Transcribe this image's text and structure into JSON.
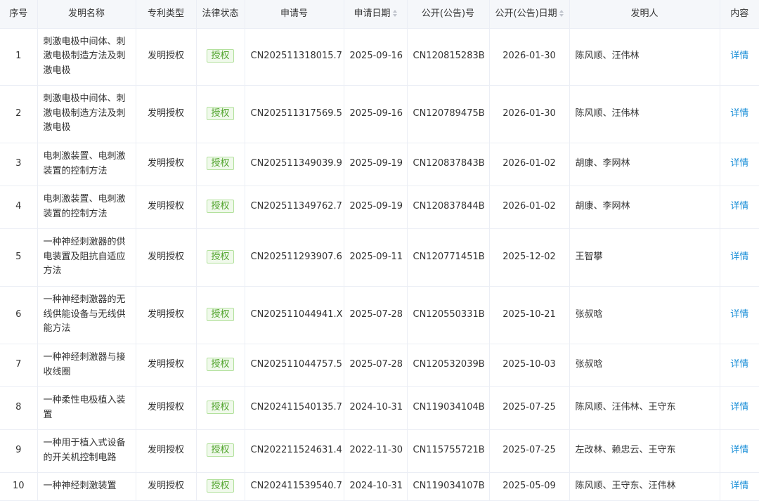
{
  "headers": {
    "index": "序号",
    "name": "发明名称",
    "type": "专利类型",
    "status": "法律状态",
    "app_no": "申请号",
    "app_date": "申请日期",
    "pub_no": "公开(公告)号",
    "pub_date": "公开(公告)日期",
    "inventor": "发明人",
    "content": "内容"
  },
  "rows": [
    {
      "index": "1",
      "name": "刺激电极中间体、刺激电极制造方法及刺激电极",
      "type": "发明授权",
      "status": "授权",
      "app_no": "CN202511318015.7",
      "app_date": "2025-09-16",
      "pub_no": "CN120815283B",
      "pub_date": "2026-01-30",
      "inventor": "陈风顺、汪伟林",
      "detail": "详情"
    },
    {
      "index": "2",
      "name": "刺激电极中间体、刺激电极制造方法及刺激电极",
      "type": "发明授权",
      "status": "授权",
      "app_no": "CN202511317569.5",
      "app_date": "2025-09-16",
      "pub_no": "CN120789475B",
      "pub_date": "2026-01-30",
      "inventor": "陈风顺、汪伟林",
      "detail": "详情"
    },
    {
      "index": "3",
      "name": "电刺激装置、电刺激装置的控制方法",
      "type": "发明授权",
      "status": "授权",
      "app_no": "CN202511349039.9",
      "app_date": "2025-09-19",
      "pub_no": "CN120837843B",
      "pub_date": "2026-01-02",
      "inventor": "胡康、李网林",
      "detail": "详情"
    },
    {
      "index": "4",
      "name": "电刺激装置、电刺激装置的控制方法",
      "type": "发明授权",
      "status": "授权",
      "app_no": "CN202511349762.7",
      "app_date": "2025-09-19",
      "pub_no": "CN120837844B",
      "pub_date": "2026-01-02",
      "inventor": "胡康、李网林",
      "detail": "详情"
    },
    {
      "index": "5",
      "name": "一种神经刺激器的供电装置及阻抗自适应方法",
      "type": "发明授权",
      "status": "授权",
      "app_no": "CN202511293907.6",
      "app_date": "2025-09-11",
      "pub_no": "CN120771451B",
      "pub_date": "2025-12-02",
      "inventor": "王智攀",
      "detail": "详情"
    },
    {
      "index": "6",
      "name": "一种神经刺激器的无线供能设备与无线供能方法",
      "type": "发明授权",
      "status": "授权",
      "app_no": "CN202511044941.X",
      "app_date": "2025-07-28",
      "pub_no": "CN120550331B",
      "pub_date": "2025-10-21",
      "inventor": "张叔晗",
      "detail": "详情"
    },
    {
      "index": "7",
      "name": "一种神经刺激器与接收线圈",
      "type": "发明授权",
      "status": "授权",
      "app_no": "CN202511044757.5",
      "app_date": "2025-07-28",
      "pub_no": "CN120532039B",
      "pub_date": "2025-10-03",
      "inventor": "张叔晗",
      "detail": "详情"
    },
    {
      "index": "8",
      "name": "一种柔性电极植入装置",
      "type": "发明授权",
      "status": "授权",
      "app_no": "CN202411540135.7",
      "app_date": "2024-10-31",
      "pub_no": "CN119034104B",
      "pub_date": "2025-07-25",
      "inventor": "陈风顺、汪伟林、王守东",
      "detail": "详情"
    },
    {
      "index": "9",
      "name": "一种用于植入式设备的开关机控制电路",
      "type": "发明授权",
      "status": "授权",
      "app_no": "CN202211524631.4",
      "app_date": "2022-11-30",
      "pub_no": "CN115755721B",
      "pub_date": "2025-07-25",
      "inventor": "左改林、赖忠云、王守东",
      "detail": "详情"
    },
    {
      "index": "10",
      "name": "一种神经刺激装置",
      "type": "发明授权",
      "status": "授权",
      "app_no": "CN202411539540.7",
      "app_date": "2024-10-31",
      "pub_no": "CN119034107B",
      "pub_date": "2025-05-09",
      "inventor": "陈风顺、王守东、汪伟林",
      "detail": "详情"
    }
  ]
}
